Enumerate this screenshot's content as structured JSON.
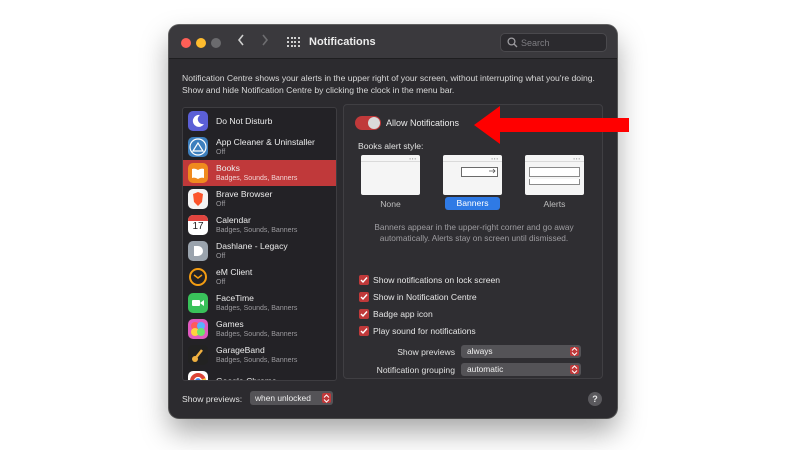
{
  "window": {
    "title": "Notifications"
  },
  "search": {
    "placeholder": "Search"
  },
  "description": "Notification Centre shows your alerts in the upper right of your screen, without interrupting what you're doing. Show and hide Notification Centre by clicking the clock in the menu bar.",
  "apps": [
    {
      "name": "Do Not Disturb",
      "subtitle": "",
      "icon": "moon-icon",
      "color": "#5b5fd6"
    },
    {
      "name": "App Cleaner & Uninstaller",
      "subtitle": "Off",
      "icon": "app-cleaner-icon",
      "color": "#3d7fbd"
    },
    {
      "name": "Books",
      "subtitle": "Badges, Sounds, Banners",
      "icon": "books-icon",
      "color": "#f08a1e",
      "selected": true
    },
    {
      "name": "Brave Browser",
      "subtitle": "Off",
      "icon": "brave-icon",
      "color": "#f4f4f4"
    },
    {
      "name": "Calendar",
      "subtitle": "Badges, Sounds, Banners",
      "icon": "calendar-icon",
      "color": "#ffffff"
    },
    {
      "name": "Dashlane - Legacy",
      "subtitle": "Off",
      "icon": "dashlane-icon",
      "color": "#9aa3ad"
    },
    {
      "name": "eM Client",
      "subtitle": "Off",
      "icon": "em-client-icon",
      "color": "#f39c12"
    },
    {
      "name": "FaceTime",
      "subtitle": "Badges, Sounds, Banners",
      "icon": "facetime-icon",
      "color": "#39c15a"
    },
    {
      "name": "Games",
      "subtitle": "Badges, Sounds, Banners",
      "icon": "games-icon",
      "color": "#e05abf"
    },
    {
      "name": "GarageBand",
      "subtitle": "Badges, Sounds, Banners",
      "icon": "garageband-icon",
      "color": "#222222"
    },
    {
      "name": "Google Chrome",
      "subtitle": "",
      "icon": "chrome-icon",
      "color": "#ffffff"
    }
  ],
  "detail": {
    "allow_label": "Allow Notifications",
    "alert_style_label": "Books alert style:",
    "styles": [
      {
        "label": "None",
        "selected": false
      },
      {
        "label": "Banners",
        "selected": true
      },
      {
        "label": "Alerts",
        "selected": false
      }
    ],
    "explain": "Banners appear in the upper-right corner and go away automatically. Alerts stay on screen until dismissed.",
    "checkboxes": [
      {
        "label": "Show notifications on lock screen",
        "checked": true
      },
      {
        "label": "Show in Notification Centre",
        "checked": true
      },
      {
        "label": "Badge app icon",
        "checked": true
      },
      {
        "label": "Play sound for notifications",
        "checked": true
      }
    ],
    "show_previews": {
      "label": "Show previews",
      "value": "always"
    },
    "grouping": {
      "label": "Notification grouping",
      "value": "automatic"
    }
  },
  "footer": {
    "show_previews_label": "Show previews:",
    "show_previews_value": "when unlocked",
    "help": "?"
  },
  "colors": {
    "accent": "#c0393a",
    "selected_blue": "#2f7ae5",
    "arrow": "#ff0000"
  }
}
